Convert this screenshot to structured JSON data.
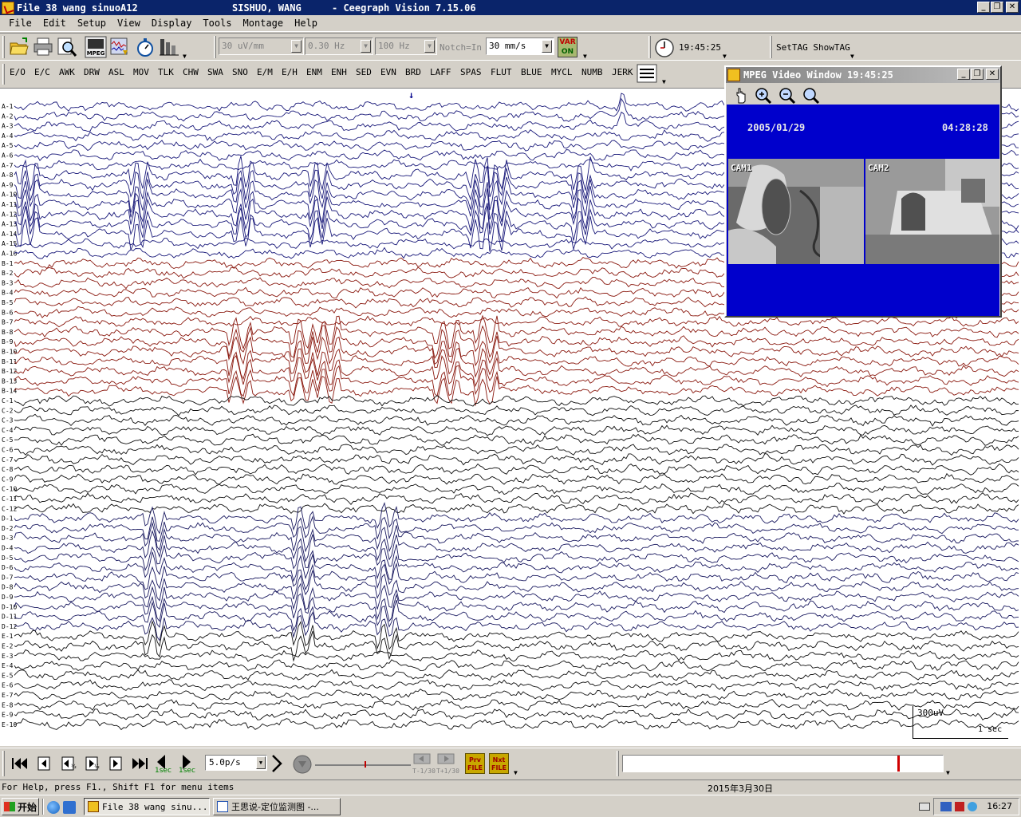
{
  "window": {
    "title_file": "File 38   wang sinuoA12",
    "title_patient": "SISHUO, WANG",
    "title_app": "- Ceegraph Vision  7.15.06",
    "buttons": [
      "_",
      "❐",
      "✕"
    ]
  },
  "menu": [
    "File",
    "Edit",
    "Setup",
    "View",
    "Display",
    "Tools",
    "Montage",
    "Help"
  ],
  "toolbar": {
    "sensitivity": "30 uV/mm",
    "low_filter": "0.30 Hz",
    "high_filter": "100 Hz",
    "notch": "Notch=In",
    "paper_speed": "30 mm/s",
    "var_label": "VAR",
    "var_state": "ON",
    "clock_time": "19:45:25",
    "tag_buttons": "SetTAG ShowTAG"
  },
  "event_tags": [
    "E/O",
    "E/C",
    "AWK",
    "DRW",
    "ASL",
    "MOV",
    "TLK",
    "CHW",
    "SWA",
    "SNO",
    "E/M",
    "E/H",
    "ENM",
    "ENH",
    "SED",
    "EVN",
    "BRD",
    "LAFF",
    "SPAS",
    "FLUT",
    "BLUE",
    "MYCL",
    "NUMB",
    "JERK"
  ],
  "channels": {
    "groups": [
      {
        "prefix": "A",
        "count": 16,
        "color": "#1a1a7a"
      },
      {
        "prefix": "B",
        "count": 14,
        "color": "#8b1a10"
      },
      {
        "prefix": "C",
        "count": 12,
        "color": "#101010"
      },
      {
        "prefix": "D",
        "count": 12,
        "color": "#1a1a60"
      },
      {
        "prefix": "E",
        "count": 10,
        "color": "#101010"
      }
    ],
    "first_label": "A-1"
  },
  "scale": {
    "amplitude": "300uV",
    "time": "1 sec"
  },
  "video": {
    "title": "MPEG Video Window  19:45:25",
    "date": "2005/01/29",
    "time": "04:28:28",
    "cam1": "CAM1",
    "cam2": "CAM2"
  },
  "controls": {
    "speed": "5.0p/s",
    "step_label": "1sec",
    "t_minus": "T-1/30",
    "t_plus": "T+1/30",
    "prev_file": "Prv FILE",
    "next_file": "Nxt FILE",
    "position_fraction": 0.86
  },
  "status": {
    "help": "For Help, press F1., Shift F1 for menu items",
    "date": "2015年3月30日"
  },
  "taskbar": {
    "start": "开始",
    "task1": "File 38   wang sinu...",
    "task2": "王思说-定位监测图 -...",
    "clock": "16:27"
  }
}
